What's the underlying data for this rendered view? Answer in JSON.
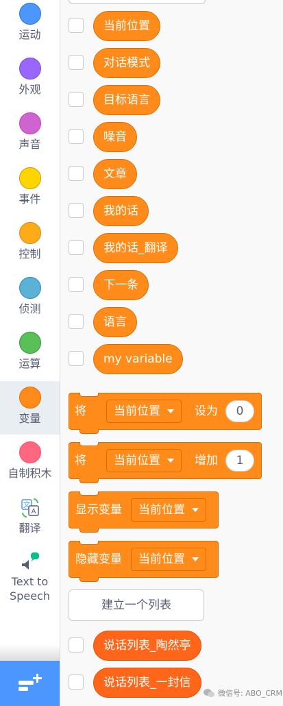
{
  "sidebar": {
    "categories": [
      {
        "label": "运动",
        "color": "#4c97ff"
      },
      {
        "label": "外观",
        "color": "#9966ff"
      },
      {
        "label": "声音",
        "color": "#cf63cf"
      },
      {
        "label": "事件",
        "color": "#ffd500"
      },
      {
        "label": "控制",
        "color": "#ffab19"
      },
      {
        "label": "侦测",
        "color": "#5cb1d6"
      },
      {
        "label": "运算",
        "color": "#59c059"
      },
      {
        "label": "变量",
        "color": "#ff8c1a"
      },
      {
        "label": "自制积木",
        "color": "#ff6680"
      }
    ],
    "translate_label": "翻译",
    "tts_label_line1": "Text to",
    "tts_label_line2": "Speech",
    "selected": "变量"
  },
  "palette": {
    "variables": [
      "当前位置",
      "对话模式",
      "目标语言",
      "噪音",
      "文章",
      "我的话",
      "我的话_翻译",
      "下一条",
      "语言",
      "my variable"
    ],
    "set_block": {
      "label": "将",
      "dropdown": "当前位置",
      "action": "设为",
      "value": "0"
    },
    "change_block": {
      "label": "将",
      "dropdown": "当前位置",
      "action": "增加",
      "value": "1"
    },
    "show_block": {
      "label": "显示变量",
      "dropdown": "当前位置"
    },
    "hide_block": {
      "label": "隐藏变量",
      "dropdown": "当前位置"
    },
    "make_list_label": "建立一个列表",
    "lists": [
      "说话列表_陶然亭",
      "说话列表_一封信"
    ]
  },
  "watermark": "微信号: ABO_CRM",
  "colors": {
    "variable_block": "#ff8c1a",
    "list_block": "#ff661a",
    "extension_button": "#4c97ff"
  }
}
